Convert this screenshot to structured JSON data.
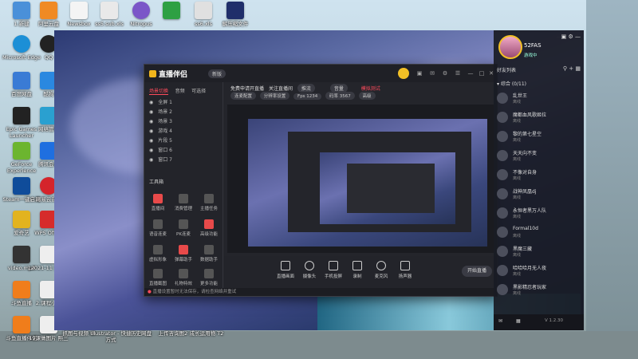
{
  "desktop_icons": [
    {
      "label": "1.新建",
      "color": "#4a90d9"
    },
    {
      "label": "阿里云盘",
      "color": "#f08a24"
    },
    {
      "label": "Newsbox",
      "color": "#f4f4f4"
    },
    {
      "label": "ss5.sub.xls",
      "color": "#e9e9e9"
    },
    {
      "label": "Nitropus",
      "color": "#7b56c8"
    },
    {
      "label": "",
      "color": "#2ea043"
    },
    {
      "label": "ss6.xls",
      "color": "#e0e0e0"
    },
    {
      "label": "解压缩文件",
      "color": "#1f2e6a"
    },
    {
      "label": "Microsoft Edge",
      "color": "#1c8fd6"
    },
    {
      "label": "QQ",
      "color": "#222"
    },
    {
      "label": "百度网盘",
      "color": "#3a7bd5"
    },
    {
      "label": "酷狗",
      "color": "#2a88e0"
    },
    {
      "label": "Epic Games Launcher",
      "color": "#222"
    },
    {
      "label": "网络管理",
      "color": "#2aa0d0"
    },
    {
      "label": "GeForce Experience",
      "color": "#6cb52f"
    },
    {
      "label": "腾讯会议",
      "color": "#1f6fe0"
    },
    {
      "label": "Steam一键启动",
      "color": "#0f4c9a"
    },
    {
      "label": "网易云音乐",
      "color": "#d4242b"
    },
    {
      "label": "爱奇艺",
      "color": "#e2b31f"
    },
    {
      "label": "WPS Office",
      "color": "#d62b2b"
    },
    {
      "label": "video.mp4",
      "color": "#333"
    },
    {
      "label": "12021-11 完成品",
      "color": "#eee"
    },
    {
      "label": "斗鱼直播",
      "color": "#f07d1b"
    },
    {
      "label": "2.课程小结",
      "color": "#eee"
    },
    {
      "label": "斗鱼直播伴侣",
      "color": "#f07d1b"
    },
    {
      "label": "19课做图片 照三",
      "color": "#eee"
    }
  ],
  "bottom_desktop_labels": [
    "抓图与视频 UI",
    "Illustrator - 快捷方式",
    "历史网盘",
    "上传咨询图2",
    "成长运用物 T2"
  ],
  "app": {
    "title": "直播伴侣",
    "version": "新版",
    "left_tabs": [
      "场景切换",
      "音频",
      "可选择"
    ],
    "scenes": [
      "全屏 1",
      "场景 2",
      "场景 3",
      "游戏 4",
      "片段 5",
      "窗口 6",
      "窗口 7"
    ],
    "tools_title": "工具箱",
    "tools": [
      "直播间",
      "消费管理",
      "主播任务",
      "语音连麦",
      "PK连麦",
      "高级功能",
      "虚拟形象",
      "弹幕助手",
      "数据助手",
      "直播截图",
      "礼物特效",
      "更多功能"
    ],
    "top_row": [
      "免费申请开直播",
      "关注直播间",
      "推流",
      "音量",
      "模拟测试"
    ],
    "top_row2": [
      "连麦配置",
      "分辨率设置",
      "Fps 1234",
      "码率 3567",
      "高级"
    ],
    "bottom_buttons": [
      "直播画面",
      "摄像头",
      "手机投屏",
      "录制",
      "麦克风",
      "扬声器"
    ],
    "start_button": "开始直播",
    "status_text": "直播设置暂时无法保存，请检查网络并重试"
  },
  "friends": {
    "username": "52FAS",
    "user_status": "游戏中",
    "list_title": "好友列表",
    "group": "综合 (0/11)",
    "items": [
      {
        "name": "乱世王",
        "status": "离线"
      },
      {
        "name": "魔都血风歌姬拉",
        "status": "离线"
      },
      {
        "name": "黎的第七星空",
        "status": "离线"
      },
      {
        "name": "天天向不变",
        "status": "离线"
      },
      {
        "name": "不像对自身",
        "status": "离线"
      },
      {
        "name": "战神凤凰dj",
        "status": "离线"
      },
      {
        "name": "永恒者黑万人队",
        "status": "离线"
      },
      {
        "name": "Formal10d",
        "status": "离线"
      },
      {
        "name": "黑魔三藏",
        "status": "离线"
      },
      {
        "name": "哈哈哈月无人夜",
        "status": "离线"
      },
      {
        "name": "黑影精忍者玩家",
        "status": "离线"
      }
    ],
    "footer_version": "V 1.2.30"
  }
}
